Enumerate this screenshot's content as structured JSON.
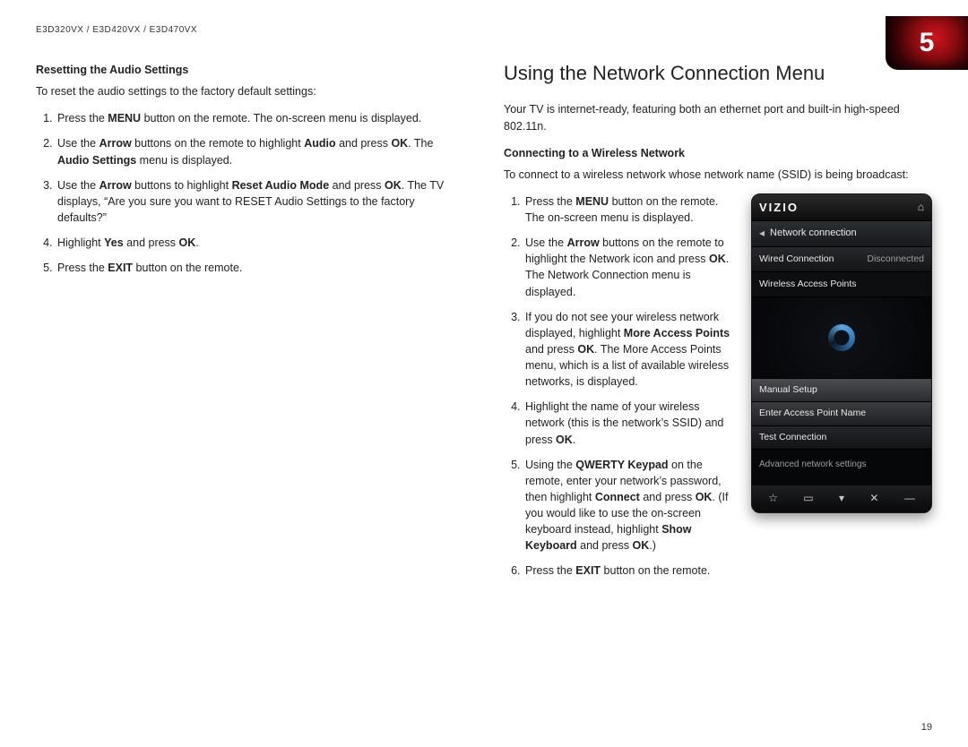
{
  "header": {
    "models": "E3D320VX / E3D420VX / E3D470VX",
    "chapter": "5"
  },
  "page_number": "19",
  "left": {
    "title": "Resetting the Audio Settings",
    "intro": "To reset the audio settings to the factory default settings:",
    "steps": {
      "s1a": "Press the ",
      "s1b": "MENU",
      "s1c": " button on the remote. The on-screen menu is displayed.",
      "s2a": "Use the ",
      "s2b": "Arrow",
      "s2c": " buttons on the remote to highlight ",
      "s2d": "Audio",
      "s2e": " and press ",
      "s2f": "OK",
      "s2g": ". The ",
      "s2h": "Audio Settings",
      "s2i": " menu is displayed.",
      "s3a": "Use the ",
      "s3b": "Arrow",
      "s3c": " buttons to highlight ",
      "s3d": "Reset Audio Mode",
      "s3e": " and press ",
      "s3f": "OK",
      "s3g": ". The TV displays, “Are you sure you want to RESET Audio Settings to the factory defaults?”",
      "s4a": "Highlight ",
      "s4b": "Yes",
      "s4c": " and press ",
      "s4d": "OK",
      "s4e": ".",
      "s5a": "Press the ",
      "s5b": "EXIT",
      "s5c": " button on the remote."
    }
  },
  "right": {
    "heading": "Using the Network Connection Menu",
    "intro": "Your TV is internet-ready, featuring both an ethernet port and built-in high-speed 802.11n.",
    "sub": "Connecting to a Wireless Network",
    "sub_intro": "To connect to a wireless network whose network name (SSID) is being broadcast:",
    "steps": {
      "s1a": "Press the ",
      "s1b": "MENU",
      "s1c": " button on the remote. The on-screen menu is displayed.",
      "s2a": "Use the ",
      "s2b": "Arrow",
      "s2c": " buttons on the remote to highlight the Network icon and press ",
      "s2d": "OK",
      "s2e": ". The Network Connection menu is displayed.",
      "s3a": "If you do not see your wireless network displayed, highlight ",
      "s3b": "More Access Points",
      "s3c": " and press ",
      "s3d": "OK",
      "s3e": ". The More Access Points menu, which is a list of available wireless networks, is displayed.",
      "s4": "Highlight the name of your wireless network (this is the network’s SSID) and press ",
      "s4b": "OK",
      "s4c": ".",
      "s5a": "Using the ",
      "s5b": "QWERTY Keypad",
      "s5c": " on the remote, enter your network’s password, then highlight ",
      "s5d": "Connect",
      "s5e": " and press ",
      "s5f": "OK",
      "s5g": ". (If you would like to use the on-screen keyboard instead, highlight ",
      "s5h": "Show Keyboard",
      "s5i": " and press ",
      "s5j": "OK",
      "s5k": ".)",
      "s6a": "Press the ",
      "s6b": "EXIT",
      "s6c": " button on the remote."
    }
  },
  "device": {
    "brand": "VIZIO",
    "title": "Network connection",
    "wired_label": "Wired Connection",
    "wired_value": "Disconnected",
    "wap": "Wireless Access Points",
    "manual": "Manual Setup",
    "enter": "Enter Access Point Name",
    "test": "Test Connection",
    "advanced": "Advanced network settings"
  }
}
